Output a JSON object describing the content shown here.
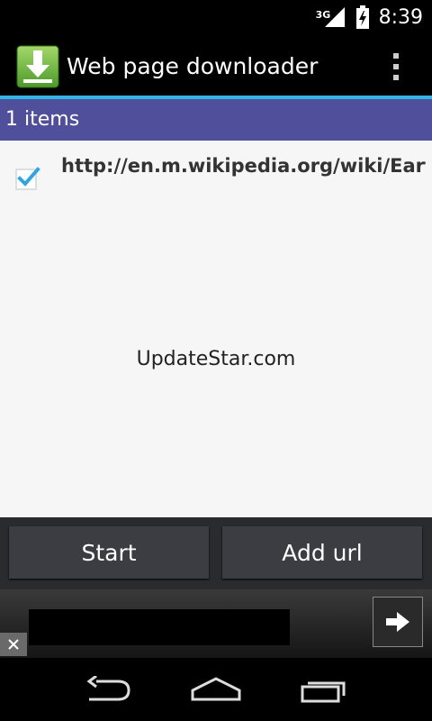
{
  "status_bar": {
    "network_type": "3G",
    "time": "8:39",
    "icons": [
      "signal-icon",
      "battery-icon"
    ]
  },
  "action_bar": {
    "title": "Web page downloader",
    "icons": [
      "download-app-icon",
      "overflow-menu-icon"
    ]
  },
  "list_header": {
    "text": "1  items"
  },
  "items": [
    {
      "url": "http://en.m.wikipedia.org/wiki/Earth",
      "checked": true
    }
  ],
  "watermark": "UpdateStar.com",
  "buttons": {
    "start_label": "Start",
    "add_url_label": "Add url"
  },
  "ad": {
    "icons": [
      "arrow-right-icon",
      "close-icon"
    ]
  },
  "nav_bar": {
    "icons": [
      "back-icon",
      "home-icon",
      "recent-apps-icon"
    ]
  },
  "colors": {
    "accent": "#33b5e5",
    "header_bg": "#4f4f9b",
    "content_bg": "#f6f6f6",
    "button_bg": "#3b3d42"
  }
}
